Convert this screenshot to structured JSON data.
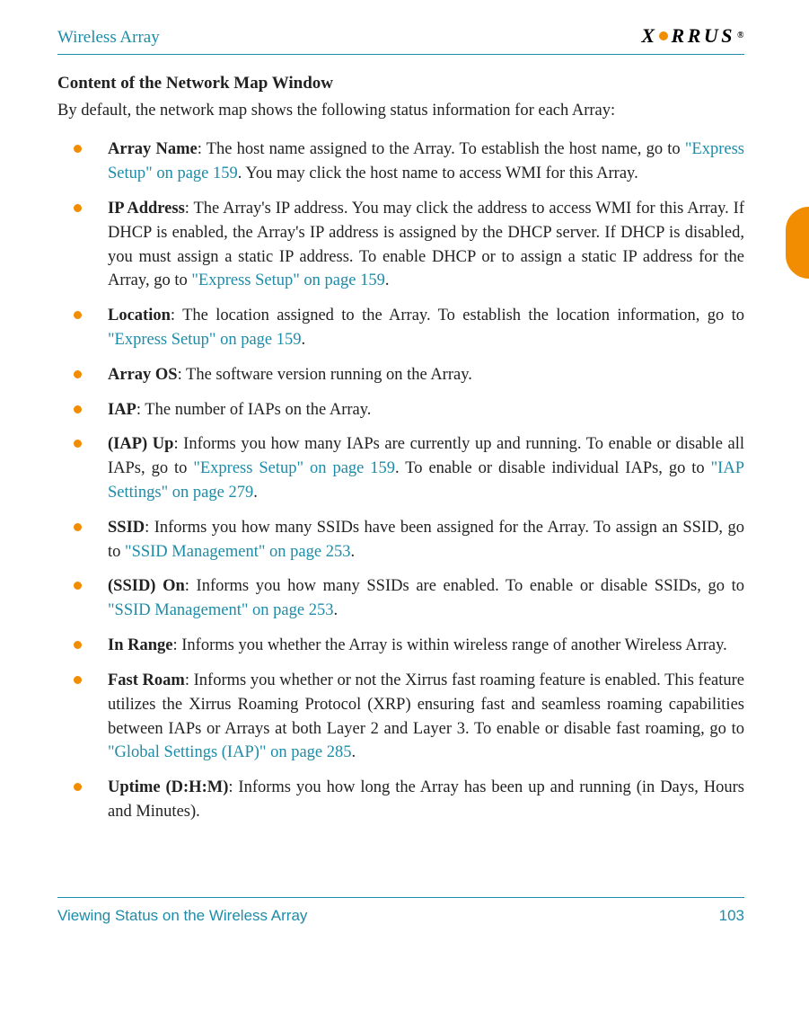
{
  "header": {
    "title": "Wireless Array",
    "logo_text": "XIRRUS",
    "logo_trademark": "®"
  },
  "section": {
    "title": "Content of the Network Map Window",
    "intro": "By default, the network map shows the following status information for each Array:"
  },
  "items": [
    {
      "term": "Array Name",
      "p1": ": The host name assigned to the Array. To establish the host name, go to ",
      "link1": "\"Express Setup\" on page 159",
      "p2": ". You may click the host name to access WMI for this Array."
    },
    {
      "term": "IP Address",
      "p1": ": The Array's IP address. You may click the address to access WMI for this Array. If DHCP is enabled, the Array's IP address is assigned by the DHCP server. If DHCP is disabled, you must assign a static IP address. To enable DHCP or to assign a static IP address for the Array, go to ",
      "link1": "\"Express Setup\" on page 159",
      "p2": "."
    },
    {
      "term": "Location",
      "p1": ": The location assigned to the Array. To establish the location information, go to ",
      "link1": "\"Express Setup\" on page 159",
      "p2": "."
    },
    {
      "term": "Array OS",
      "p1": ": The software version running on the Array."
    },
    {
      "term": "IAP",
      "p1": ": The number of IAPs on the Array."
    },
    {
      "term": "(IAP) Up",
      "p1": ": Informs you how many IAPs are currently up and running. To enable or disable all IAPs, go to ",
      "link1": "\"Express Setup\" on page 159",
      "p2": ". To enable or disable individual IAPs, go to ",
      "link2": "\"IAP Settings\" on page 279",
      "p3": "."
    },
    {
      "term": "SSID",
      "p1": ": Informs you how many SSIDs have been assigned for the Array. To assign an SSID, go to ",
      "link1": "\"SSID Management\" on page 253",
      "p2": "."
    },
    {
      "term": "(SSID) On",
      "p1": ": Informs you how many SSIDs are enabled. To enable or disable SSIDs, go to ",
      "link1": "\"SSID Management\" on page 253",
      "p2": "."
    },
    {
      "term": "In Range",
      "p1": ": Informs you whether the Array is within wireless range of another Wireless Array."
    },
    {
      "term": "Fast Roam",
      "p1": ": Informs you whether or not the Xirrus fast roaming feature is enabled. This feature utilizes the Xirrus Roaming Protocol (XRP) ensuring fast and seamless roaming capabilities between IAPs or Arrays at both Layer 2 and Layer 3. To enable or disable fast roaming, go to ",
      "link1": "\"Global Settings (IAP)\" on page 285",
      "p2": "."
    },
    {
      "term": "Uptime (D:H:M)",
      "p1": ": Informs you how long the Array has been up and running (in Days, Hours and Minutes)."
    }
  ],
  "footer": {
    "section": "Viewing Status on the Wireless Array",
    "page": "103"
  }
}
